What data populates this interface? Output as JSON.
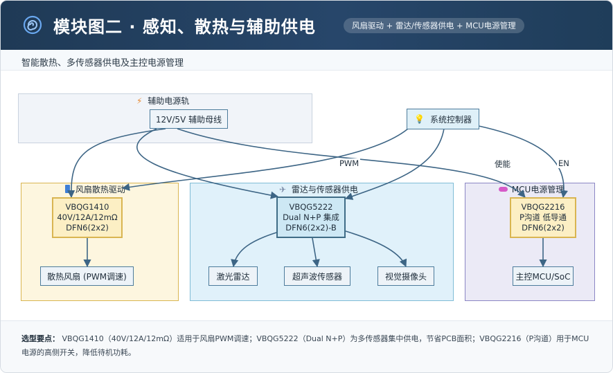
{
  "header": {
    "title": "模块图二 · 感知、散热与辅助供电",
    "tag": "风扇驱动 + 雷达/传感器供电 + MCU电源管理"
  },
  "subtitle": "智能散热、多传感器供电及主控电源管理",
  "groups": {
    "aux_rail": "辅助电源轨",
    "fan": "风扇散热驱动",
    "radar": "雷达与传感器供电",
    "mcu": "MCU电源管理"
  },
  "nodes": {
    "aux_bus": "12V/5V 辅助母线",
    "sys_ctrl": "系统控制器",
    "fan_chip": [
      "VBQG1410",
      "40V/12A/12mΩ",
      "DFN6(2x2)"
    ],
    "radar_chip": [
      "VBQG5222",
      "Dual N+P 集成",
      "DFN6(2x2)-B"
    ],
    "mcu_chip": [
      "VBQG2216",
      "P沟道 低导通",
      "DFN6(2x2)"
    ],
    "fan": "散热风扇 (PWM调速)",
    "lidar": "激光雷达",
    "ultrasonic": "超声波传感器",
    "camera": "视觉摄像头",
    "mcu": "主控MCU/SoC"
  },
  "edges": {
    "pwm": "PWM",
    "enable": "使能",
    "en": "EN"
  },
  "footer": {
    "label": "选型要点：",
    "text": "VBQG1410（40V/12A/12mΩ）适用于风扇PWM调速；VBQG5222（Dual N+P）为多传感器集中供电，节省PCB面积；VBQG2216（P沟道）用于MCU电源的高侧开关，降低待机功耗。"
  },
  "colors": {
    "header_bg": "#1f3a56",
    "edge": "#3d6585",
    "aux_fill": "#f1f4f9",
    "fan_fill": "#fdf6df",
    "fan_border": "#d9b551",
    "radar_fill": "#e0f1fa",
    "radar_border": "#7fbcd6",
    "mcu_fill": "#ebeaf6",
    "mcu_border": "#8b86c4"
  },
  "icons": {
    "header": "spiral-icon",
    "aux_rail": "lightning-icon",
    "sys_ctrl": "lightbulb-icon",
    "fan": "battery-icon",
    "radar": "satellite-icon",
    "mcu": "pill-icon"
  }
}
